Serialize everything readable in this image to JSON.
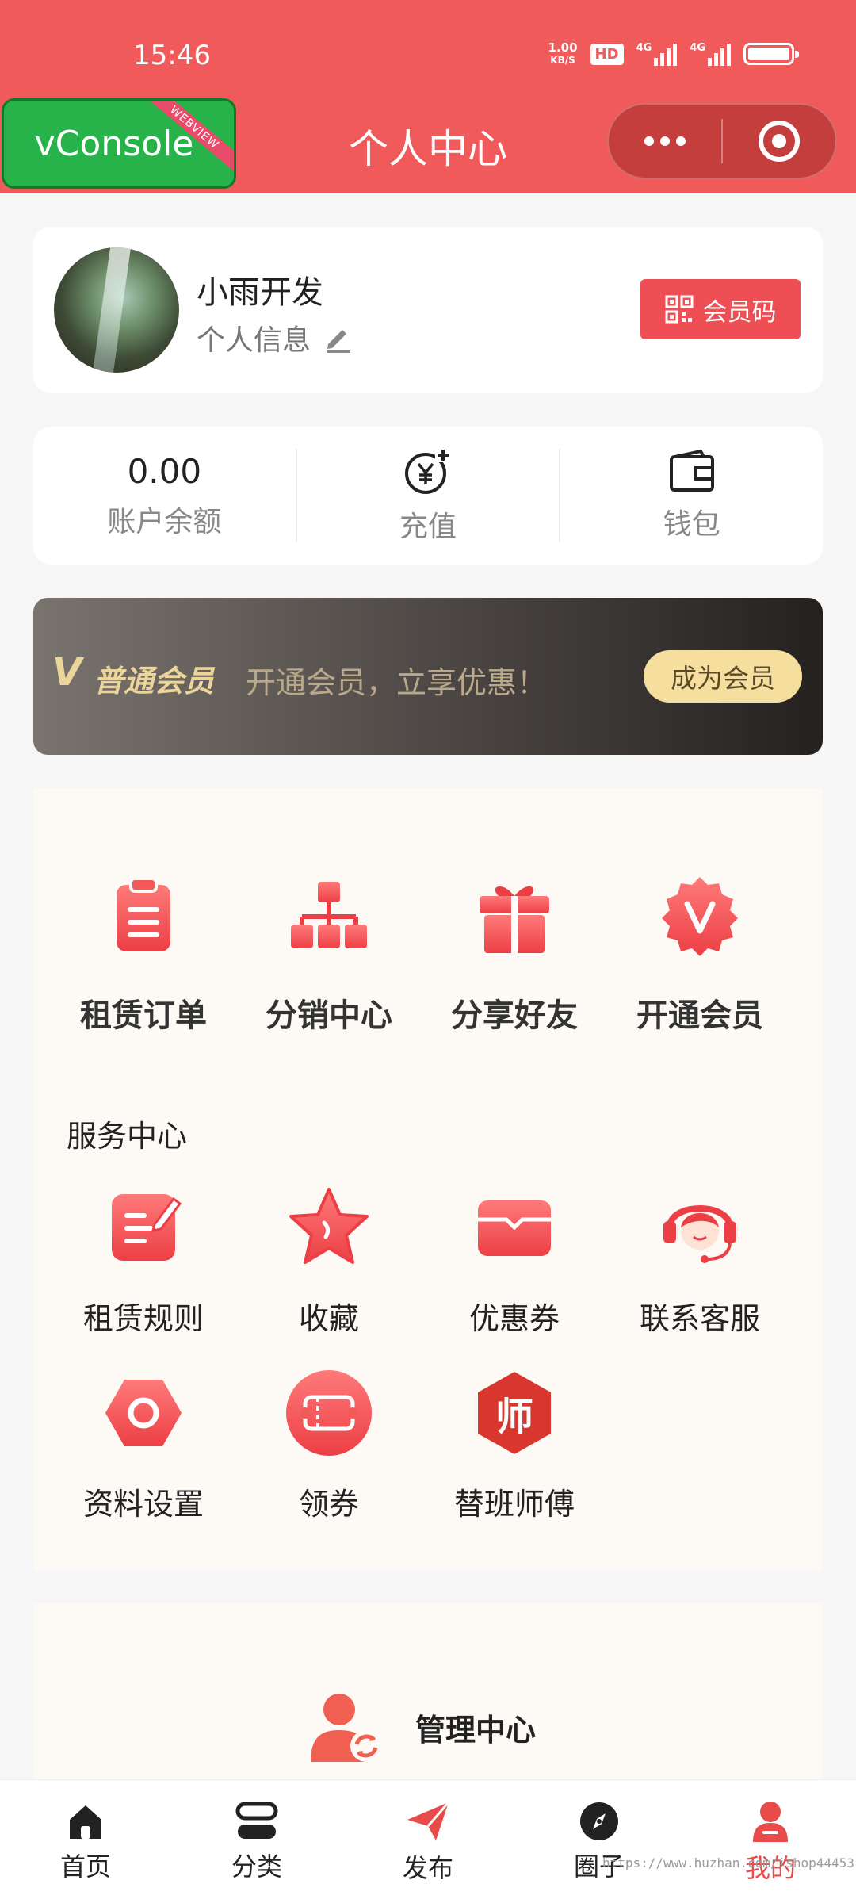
{
  "status_bar": {
    "time": "15:46",
    "net_speed_value": "1.00",
    "net_speed_unit": "KB/S",
    "hd_badge": "HD",
    "signal_1_label": "4G",
    "signal_2_label": "4G",
    "battery_icon": "battery-icon"
  },
  "header": {
    "vconsole_label": "vConsole",
    "vconsole_ribbon": "WEBVIEW",
    "title": "个人中心",
    "more_icon": "more-dots-icon",
    "close_icon": "target-circle-icon"
  },
  "profile": {
    "name": "小雨开发",
    "info_label": "个人信息",
    "edit_icon": "pencil-icon",
    "member_code_label": "会员码",
    "member_code_icon": "qrcode-icon"
  },
  "wallet": {
    "balance_value": "0.00",
    "balance_label": "账户余额",
    "recharge_label": "充值",
    "recharge_icon": "yen-plus-icon",
    "wallet_label": "钱包",
    "wallet_icon": "wallet-icon"
  },
  "vip": {
    "badge": "V",
    "title": "普通会员",
    "description": "开通会员，立享优惠！",
    "button_label": "成为会员"
  },
  "quick_menu": [
    {
      "label": "租赁订单",
      "icon": "clipboard-icon"
    },
    {
      "label": "分销中心",
      "icon": "hierarchy-icon"
    },
    {
      "label": "分享好友",
      "icon": "gift-icon"
    },
    {
      "label": "开通会员",
      "icon": "vip-badge-icon"
    }
  ],
  "service_center": {
    "title": "服务中心",
    "items": [
      {
        "label": "租赁规则",
        "icon": "rules-edit-icon"
      },
      {
        "label": "收藏",
        "icon": "star-icon"
      },
      {
        "label": "优惠券",
        "icon": "coupon-icon"
      },
      {
        "label": "联系客服",
        "icon": "headset-agent-icon"
      },
      {
        "label": "资料设置",
        "icon": "hexagon-settings-icon"
      },
      {
        "label": "领券",
        "icon": "ticket-icon"
      },
      {
        "label": "替班师傅",
        "icon": "master-badge-icon",
        "badge_text": "师"
      }
    ]
  },
  "admin": {
    "label": "管理中心",
    "icon": "user-refresh-icon"
  },
  "tabbar": [
    {
      "label": "首页",
      "icon": "home-icon",
      "active": false
    },
    {
      "label": "分类",
      "icon": "category-icon",
      "active": false
    },
    {
      "label": "发布",
      "icon": "send-icon",
      "active": false
    },
    {
      "label": "圈子",
      "icon": "compass-icon",
      "active": false
    },
    {
      "label": "我的",
      "icon": "user-icon",
      "active": true
    }
  ],
  "watermark": "https://www.huzhan.com/ishop44453",
  "colors": {
    "brand": "#f05a5a",
    "accent_red": "#ee4f55",
    "vip_gold": "#ecd59a",
    "active_tab": "#e94b4b"
  }
}
